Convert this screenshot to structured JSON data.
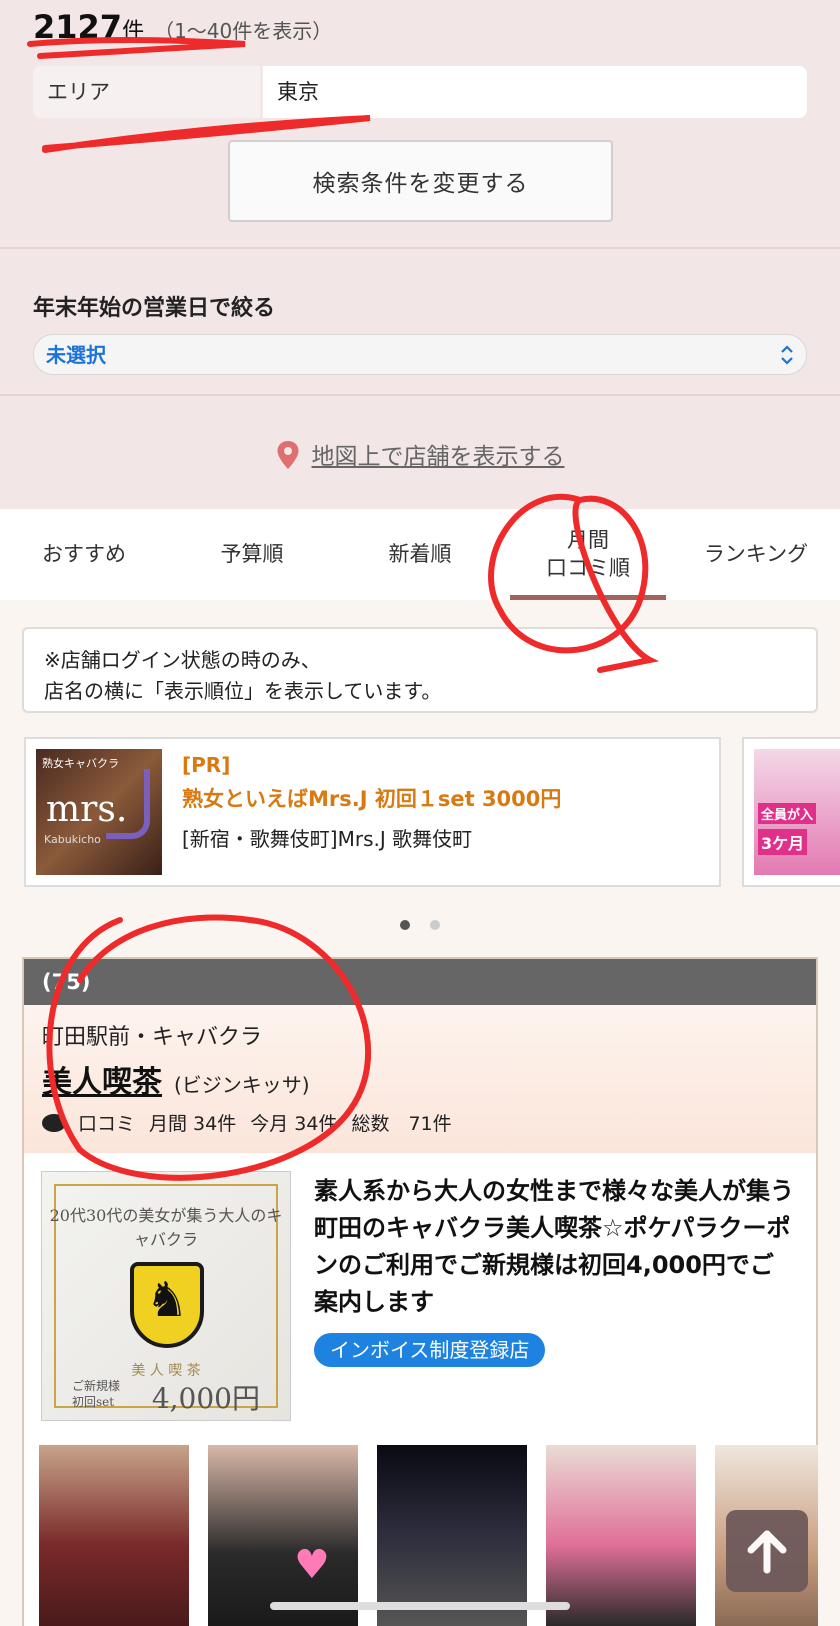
{
  "results": {
    "count": "2127",
    "unit": "件",
    "range": "（1〜40件を表示）"
  },
  "filter": {
    "label": "エリア",
    "value": "東京"
  },
  "change_button": "検索条件を変更する",
  "nenmatsu": {
    "label": "年末年始の営業日で絞る",
    "selected": "未選択"
  },
  "map_link": "地図上で店舗を表示する",
  "tabs": [
    {
      "label": "おすすめ"
    },
    {
      "label": "予算順"
    },
    {
      "label": "新着順"
    },
    {
      "label_line1": "月間",
      "label_line2": "口コミ順",
      "active": true
    },
    {
      "label": "ランキング"
    }
  ],
  "notice": {
    "line1": "※店舗ログイン状態の時のみ、",
    "line2": "店名の横に「表示順位」を表示しています。"
  },
  "pr": {
    "tag": "[PR]",
    "title": "熟女といえばMrs.J 初回１set 3000円",
    "sub": "[新宿・歌舞伎町]Mrs.J 歌舞伎町",
    "thumb_text": "mrs.",
    "thumb_small": "熟女キャバクラ",
    "thumb_small2": "Kabukicho",
    "card2_text1": "全員が入",
    "card2_text2": "3ケ月"
  },
  "shop": {
    "rank": "(75)",
    "area": "町田駅前・キャバクラ",
    "name": "美人喫茶",
    "kana": "(ビジンキッサ)",
    "stats": {
      "label": "口コミ",
      "monthly": "月間 34件",
      "this_month": "今月 34件",
      "total": "総数　71件"
    },
    "description": "素人系から大人の女性まで様々な美人が集う町田のキャバクラ美人喫茶☆ポケパラクーポンのご利用でご新規様は初回4,000円でご案内します",
    "invoice_badge": "インボイス制度登録店",
    "image": {
      "caption": "20代30代の美女が集う大人のキャバクラ",
      "brand": "美 人 喫 茶",
      "price_label1": "ご新規様",
      "price_label2": "初回set",
      "price": "4,000円"
    }
  },
  "colors": {
    "accent_tab": "#a0645c",
    "pr_orange": "#d87a12",
    "badge_blue": "#1e82e0",
    "select_blue": "#1a73d9",
    "top_bg": "#f2e6e6"
  }
}
